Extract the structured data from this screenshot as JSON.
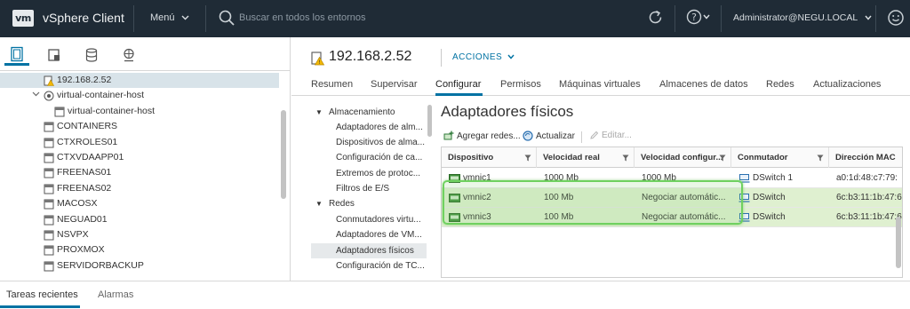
{
  "topbar": {
    "logo_text": "vm",
    "app_title": "vSphere Client",
    "menu_label": "Menú",
    "search_placeholder": "Buscar en todos los entornos",
    "user_label": "Administrator@NEGU.LOCAL"
  },
  "navigator": {
    "tabs": [
      "hosts-and-clusters-icon",
      "vms-and-templates-icon",
      "storage-icon",
      "networking-icon"
    ],
    "tree": [
      {
        "label": "192.168.2.52",
        "type": "host-warning"
      },
      {
        "label": "virtual-container-host",
        "type": "vapp"
      },
      {
        "label": "virtual-container-host",
        "type": "vm"
      },
      {
        "label": "CONTAINERS",
        "type": "vm"
      },
      {
        "label": "CTXROLES01",
        "type": "vm"
      },
      {
        "label": "CTXVDAAPP01",
        "type": "vm"
      },
      {
        "label": "FREENAS01",
        "type": "vm"
      },
      {
        "label": "FREENAS02",
        "type": "vm"
      },
      {
        "label": "MACOSX",
        "type": "vm"
      },
      {
        "label": "NEGUAD01",
        "type": "vm"
      },
      {
        "label": "NSVPX",
        "type": "vm"
      },
      {
        "label": "PROXMOX",
        "type": "vm"
      },
      {
        "label": "SERVIDORBACKUP",
        "type": "vm"
      }
    ]
  },
  "object": {
    "title": "192.168.2.52",
    "actions_label": "ACCIONES"
  },
  "tabs": [
    "Resumen",
    "Supervisar",
    "Configurar",
    "Permisos",
    "Máquinas virtuales",
    "Almacenes de datos",
    "Redes",
    "Actualizaciones"
  ],
  "active_tab": "Configurar",
  "settings": {
    "groups": [
      {
        "label": "Almacenamiento",
        "items": [
          "Adaptadores de alm...",
          "Dispositivos de alma...",
          "Configuración de ca...",
          "Extremos de protoc...",
          "Filtros de E/S"
        ]
      },
      {
        "label": "Redes",
        "items": [
          "Conmutadores virtu...",
          "Adaptadores de VM...",
          "Adaptadores físicos",
          "Configuración de TC..."
        ]
      }
    ],
    "active_item": "Adaptadores físicos"
  },
  "content": {
    "title": "Adaptadores físicos",
    "toolbar": {
      "add_label": "Agregar redes...",
      "refresh_label": "Actualizar",
      "edit_label": "Editar..."
    },
    "columns": [
      "Dispositivo",
      "Velocidad real",
      "Velocidad configur...",
      "Conmutador",
      "Dirección MAC"
    ],
    "rows": [
      {
        "device": "vmnic1",
        "actual_speed": "1000 Mb",
        "configured_speed": "1000 Mb",
        "switch": "DSwitch 1",
        "mac": "a0:1d:48:c7:79:"
      },
      {
        "device": "vmnic2",
        "actual_speed": "100 Mb",
        "configured_speed": "Negociar automátic...",
        "switch": "DSwitch",
        "mac": "6c:b3:11:1b:47:6"
      },
      {
        "device": "vmnic3",
        "actual_speed": "100 Mb",
        "configured_speed": "Negociar automátic...",
        "switch": "DSwitch",
        "mac": "6c:b3:11:1b:47:6"
      }
    ],
    "highlighted_rows": [
      "vmnic2",
      "vmnic3"
    ]
  },
  "bottom_tabs": [
    "Tareas recientes",
    "Alarmas"
  ],
  "colors": {
    "header_bg": "#1f2b36",
    "accent": "#0072a3",
    "highlight": "#6fd160"
  }
}
